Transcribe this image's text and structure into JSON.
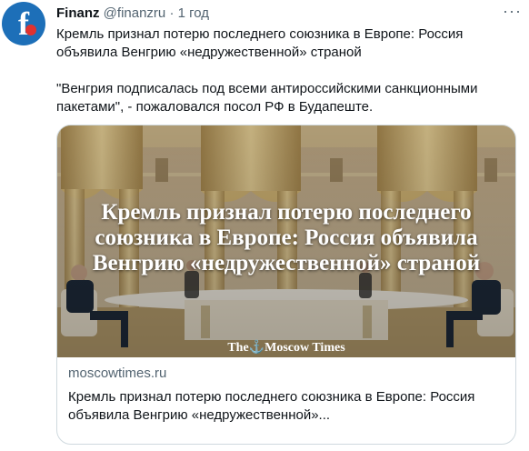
{
  "account": {
    "name": "Finanz",
    "handle": "@finanzru",
    "separator": "·",
    "time": "1 год",
    "avatar_letter": "f",
    "avatar_color": "#1d6fb8",
    "avatar_dot_color": "#e0322f"
  },
  "menu": {
    "more_glyph": "···"
  },
  "tweet": {
    "paragraphs": [
      "Кремль признал потерю последнего союзника в Европе: Россия объявила Венгрию «недружественной» страной",
      "\"Венгрия подписалась под всеми антироссийскими санкционными пакетами\", - пожаловался посол РФ в Будапеште."
    ]
  },
  "card": {
    "image_headline": "Кремль признал потерю последнего союзника в Европе: Россия объявила Венгрию «недружественной» страной",
    "brand": {
      "prefix": "The",
      "glyph": "⚓",
      "name": "Moscow Times"
    },
    "domain": "moscowtimes.ru",
    "title": "Кремль признал потерю последнего союзника в Европе: Россия объявила Венгрию «недружественной»..."
  }
}
